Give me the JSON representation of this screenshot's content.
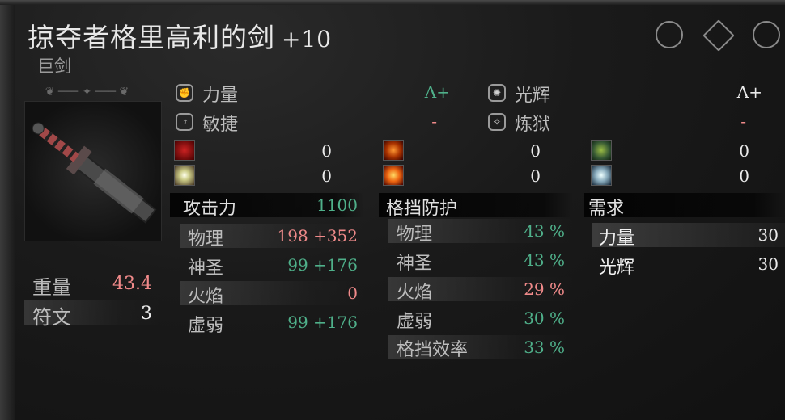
{
  "weapon": {
    "name": "掠夺者格里高利的剑",
    "level": "+10",
    "type": "巨剑"
  },
  "scaling": {
    "left": [
      {
        "label": "力量",
        "grade": "A+",
        "icon": "strength-icon"
      },
      {
        "label": "敏捷",
        "grade": "-",
        "icon": "agility-icon"
      }
    ],
    "right": [
      {
        "label": "光辉",
        "grade": "A+",
        "icon": "radiance-icon"
      },
      {
        "label": "炼狱",
        "grade": "-",
        "icon": "inferno-icon"
      }
    ]
  },
  "status_effects": [
    {
      "icon": "bleed-icon",
      "value": "0"
    },
    {
      "icon": "holy-burst-icon",
      "value": "0"
    },
    {
      "icon": "fire-icon",
      "value": "0"
    },
    {
      "icon": "explosion-icon",
      "value": "0"
    },
    {
      "icon": "poison-icon",
      "value": "0"
    },
    {
      "icon": "frost-icon",
      "value": "0"
    }
  ],
  "attack": {
    "header": "攻击力",
    "total": "1100",
    "rows": [
      {
        "label": "物理",
        "value": "198 +352"
      },
      {
        "label": "神圣",
        "value": "99 +176"
      },
      {
        "label": "火焰",
        "value": "0"
      },
      {
        "label": "虚弱",
        "value": "99 +176"
      }
    ]
  },
  "guard": {
    "header": "格挡防护",
    "rows": [
      {
        "label": "物理",
        "value": "43 %"
      },
      {
        "label": "神圣",
        "value": "43 %"
      },
      {
        "label": "火焰",
        "value": "29 %"
      },
      {
        "label": "虚弱",
        "value": "30 %"
      },
      {
        "label": "格挡效率",
        "value": "33 %"
      }
    ]
  },
  "requirements": {
    "header": "需求",
    "rows": [
      {
        "label": "力量",
        "value": "30"
      },
      {
        "label": "光辉",
        "value": "30"
      }
    ]
  },
  "misc": {
    "weight_label": "重量",
    "weight_value": "43.4",
    "rune_label": "符文",
    "rune_value": "3"
  },
  "colors": {
    "green": "#4fb08a",
    "red": "#f08a8a",
    "white": "#eaeaea"
  }
}
